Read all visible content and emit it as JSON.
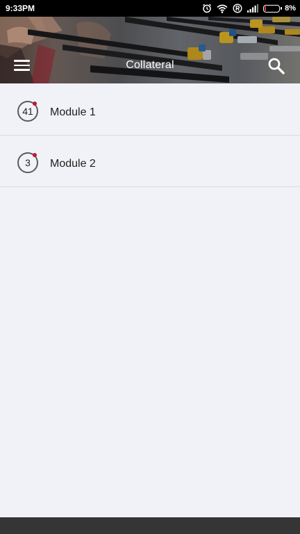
{
  "status_bar": {
    "time": "9:33PM",
    "battery_percent": "8%",
    "battery_level": 0.08,
    "icons": [
      "alarm-icon",
      "wifi-icon",
      "roaming-r-icon",
      "signal-icon",
      "battery-icon"
    ]
  },
  "header": {
    "title": "Collateral",
    "menu_icon": "hamburger-menu-icon",
    "search_icon": "search-icon"
  },
  "modules": [
    {
      "count": "41",
      "label": "Module 1"
    },
    {
      "count": "3",
      "label": "Module 2"
    }
  ],
  "colors": {
    "background": "#f0f2f7",
    "badge_dot": "#c2153a",
    "battery_low": "#e53935",
    "divider": "#d9dbe0"
  }
}
